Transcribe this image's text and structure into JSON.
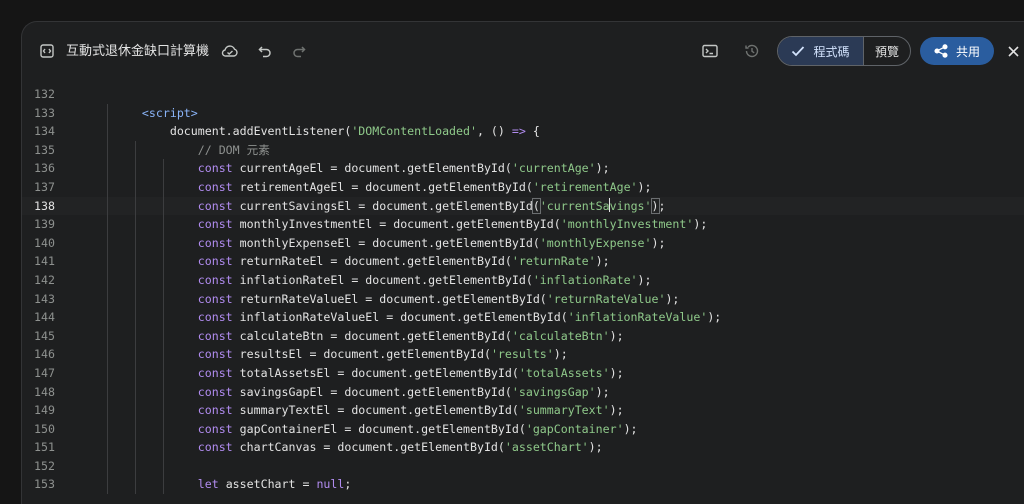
{
  "header": {
    "title": "互動式退休金缺口計算機",
    "toggle_code_label": "程式碼",
    "toggle_preview_label": "預覽",
    "share_label": "共用"
  },
  "icons": {
    "doc": "code-doc-icon",
    "cloud": "cloud-icon",
    "undo": "undo-icon",
    "redo": "redo-icon",
    "terminal": "terminal-icon",
    "history": "history-icon",
    "check": "check-icon",
    "share": "share-icon",
    "close": "close-icon"
  },
  "colors": {
    "keyword": "#b18cf0",
    "string": "#8fc98a",
    "comment": "#8e918f",
    "tag": "#8ab4f8",
    "share_button": "#2a5d9f"
  },
  "editor": {
    "active_line": "138",
    "lines": [
      {
        "n": "132",
        "tokens": []
      },
      {
        "n": "133",
        "tokens": [
          {
            "t": "<script>",
            "c": "tag"
          }
        ]
      },
      {
        "n": "134",
        "tokens": [
          {
            "t": "    document.addEventListener(",
            "c": "punct"
          },
          {
            "t": "'DOMContentLoaded'",
            "c": "str"
          },
          {
            "t": ", () ",
            "c": "punct"
          },
          {
            "t": "=>",
            "c": "kw"
          },
          {
            "t": " {",
            "c": "punct"
          }
        ]
      },
      {
        "n": "135",
        "tokens": [
          {
            "t": "        // DOM 元素",
            "c": "cmt"
          }
        ]
      },
      {
        "n": "136",
        "tokens": [
          {
            "t": "        ",
            "c": "punct"
          },
          {
            "t": "const",
            "c": "kw"
          },
          {
            "t": " currentAgeEl = document.getElementById(",
            "c": "punct"
          },
          {
            "t": "'currentAge'",
            "c": "str"
          },
          {
            "t": ");",
            "c": "punct"
          }
        ]
      },
      {
        "n": "137",
        "tokens": [
          {
            "t": "        ",
            "c": "punct"
          },
          {
            "t": "const",
            "c": "kw"
          },
          {
            "t": " retirementAgeEl = document.getElementById(",
            "c": "punct"
          },
          {
            "t": "'retirementAge'",
            "c": "str"
          },
          {
            "t": ");",
            "c": "punct"
          }
        ]
      },
      {
        "n": "138",
        "tokens": [
          {
            "t": "        ",
            "c": "punct"
          },
          {
            "t": "const",
            "c": "kw"
          },
          {
            "t": " currentSavingsEl = document.getElementById",
            "c": "punct"
          },
          {
            "t": "(",
            "c": "punct hl"
          },
          {
            "t": "'currentSa",
            "c": "str"
          },
          {
            "t": "",
            "c": "cursor"
          },
          {
            "t": "vings'",
            "c": "str"
          },
          {
            "t": ")",
            "c": "punct hl"
          },
          {
            "t": ";",
            "c": "punct"
          }
        ]
      },
      {
        "n": "139",
        "tokens": [
          {
            "t": "        ",
            "c": "punct"
          },
          {
            "t": "const",
            "c": "kw"
          },
          {
            "t": " monthlyInvestmentEl = document.getElementById(",
            "c": "punct"
          },
          {
            "t": "'monthlyInvestment'",
            "c": "str"
          },
          {
            "t": ");",
            "c": "punct"
          }
        ]
      },
      {
        "n": "140",
        "tokens": [
          {
            "t": "        ",
            "c": "punct"
          },
          {
            "t": "const",
            "c": "kw"
          },
          {
            "t": " monthlyExpenseEl = document.getElementById(",
            "c": "punct"
          },
          {
            "t": "'monthlyExpense'",
            "c": "str"
          },
          {
            "t": ");",
            "c": "punct"
          }
        ]
      },
      {
        "n": "141",
        "tokens": [
          {
            "t": "        ",
            "c": "punct"
          },
          {
            "t": "const",
            "c": "kw"
          },
          {
            "t": " returnRateEl = document.getElementById(",
            "c": "punct"
          },
          {
            "t": "'returnRate'",
            "c": "str"
          },
          {
            "t": ");",
            "c": "punct"
          }
        ]
      },
      {
        "n": "142",
        "tokens": [
          {
            "t": "        ",
            "c": "punct"
          },
          {
            "t": "const",
            "c": "kw"
          },
          {
            "t": " inflationRateEl = document.getElementById(",
            "c": "punct"
          },
          {
            "t": "'inflationRate'",
            "c": "str"
          },
          {
            "t": ");",
            "c": "punct"
          }
        ]
      },
      {
        "n": "143",
        "tokens": [
          {
            "t": "        ",
            "c": "punct"
          },
          {
            "t": "const",
            "c": "kw"
          },
          {
            "t": " returnRateValueEl = document.getElementById(",
            "c": "punct"
          },
          {
            "t": "'returnRateValue'",
            "c": "str"
          },
          {
            "t": ");",
            "c": "punct"
          }
        ]
      },
      {
        "n": "144",
        "tokens": [
          {
            "t": "        ",
            "c": "punct"
          },
          {
            "t": "const",
            "c": "kw"
          },
          {
            "t": " inflationRateValueEl = document.getElementById(",
            "c": "punct"
          },
          {
            "t": "'inflationRateValue'",
            "c": "str"
          },
          {
            "t": ");",
            "c": "punct"
          }
        ]
      },
      {
        "n": "145",
        "tokens": [
          {
            "t": "        ",
            "c": "punct"
          },
          {
            "t": "const",
            "c": "kw"
          },
          {
            "t": " calculateBtn = document.getElementById(",
            "c": "punct"
          },
          {
            "t": "'calculateBtn'",
            "c": "str"
          },
          {
            "t": ");",
            "c": "punct"
          }
        ]
      },
      {
        "n": "146",
        "tokens": [
          {
            "t": "        ",
            "c": "punct"
          },
          {
            "t": "const",
            "c": "kw"
          },
          {
            "t": " resultsEl = document.getElementById(",
            "c": "punct"
          },
          {
            "t": "'results'",
            "c": "str"
          },
          {
            "t": ");",
            "c": "punct"
          }
        ]
      },
      {
        "n": "147",
        "tokens": [
          {
            "t": "        ",
            "c": "punct"
          },
          {
            "t": "const",
            "c": "kw"
          },
          {
            "t": " totalAssetsEl = document.getElementById(",
            "c": "punct"
          },
          {
            "t": "'totalAssets'",
            "c": "str"
          },
          {
            "t": ");",
            "c": "punct"
          }
        ]
      },
      {
        "n": "148",
        "tokens": [
          {
            "t": "        ",
            "c": "punct"
          },
          {
            "t": "const",
            "c": "kw"
          },
          {
            "t": " savingsGapEl = document.getElementById(",
            "c": "punct"
          },
          {
            "t": "'savingsGap'",
            "c": "str"
          },
          {
            "t": ");",
            "c": "punct"
          }
        ]
      },
      {
        "n": "149",
        "tokens": [
          {
            "t": "        ",
            "c": "punct"
          },
          {
            "t": "const",
            "c": "kw"
          },
          {
            "t": " summaryTextEl = document.getElementById(",
            "c": "punct"
          },
          {
            "t": "'summaryText'",
            "c": "str"
          },
          {
            "t": ");",
            "c": "punct"
          }
        ]
      },
      {
        "n": "150",
        "tokens": [
          {
            "t": "        ",
            "c": "punct"
          },
          {
            "t": "const",
            "c": "kw"
          },
          {
            "t": " gapContainerEl = document.getElementById(",
            "c": "punct"
          },
          {
            "t": "'gapContainer'",
            "c": "str"
          },
          {
            "t": ");",
            "c": "punct"
          }
        ]
      },
      {
        "n": "151",
        "tokens": [
          {
            "t": "        ",
            "c": "punct"
          },
          {
            "t": "const",
            "c": "kw"
          },
          {
            "t": " chartCanvas = document.getElementById(",
            "c": "punct"
          },
          {
            "t": "'assetChart'",
            "c": "str"
          },
          {
            "t": ");",
            "c": "punct"
          }
        ]
      },
      {
        "n": "152",
        "tokens": []
      },
      {
        "n": "153",
        "tokens": [
          {
            "t": "        ",
            "c": "punct"
          },
          {
            "t": "let",
            "c": "kw"
          },
          {
            "t": " assetChart = ",
            "c": "punct"
          },
          {
            "t": "null",
            "c": "kw"
          },
          {
            "t": ";",
            "c": "punct"
          }
        ]
      }
    ]
  }
}
